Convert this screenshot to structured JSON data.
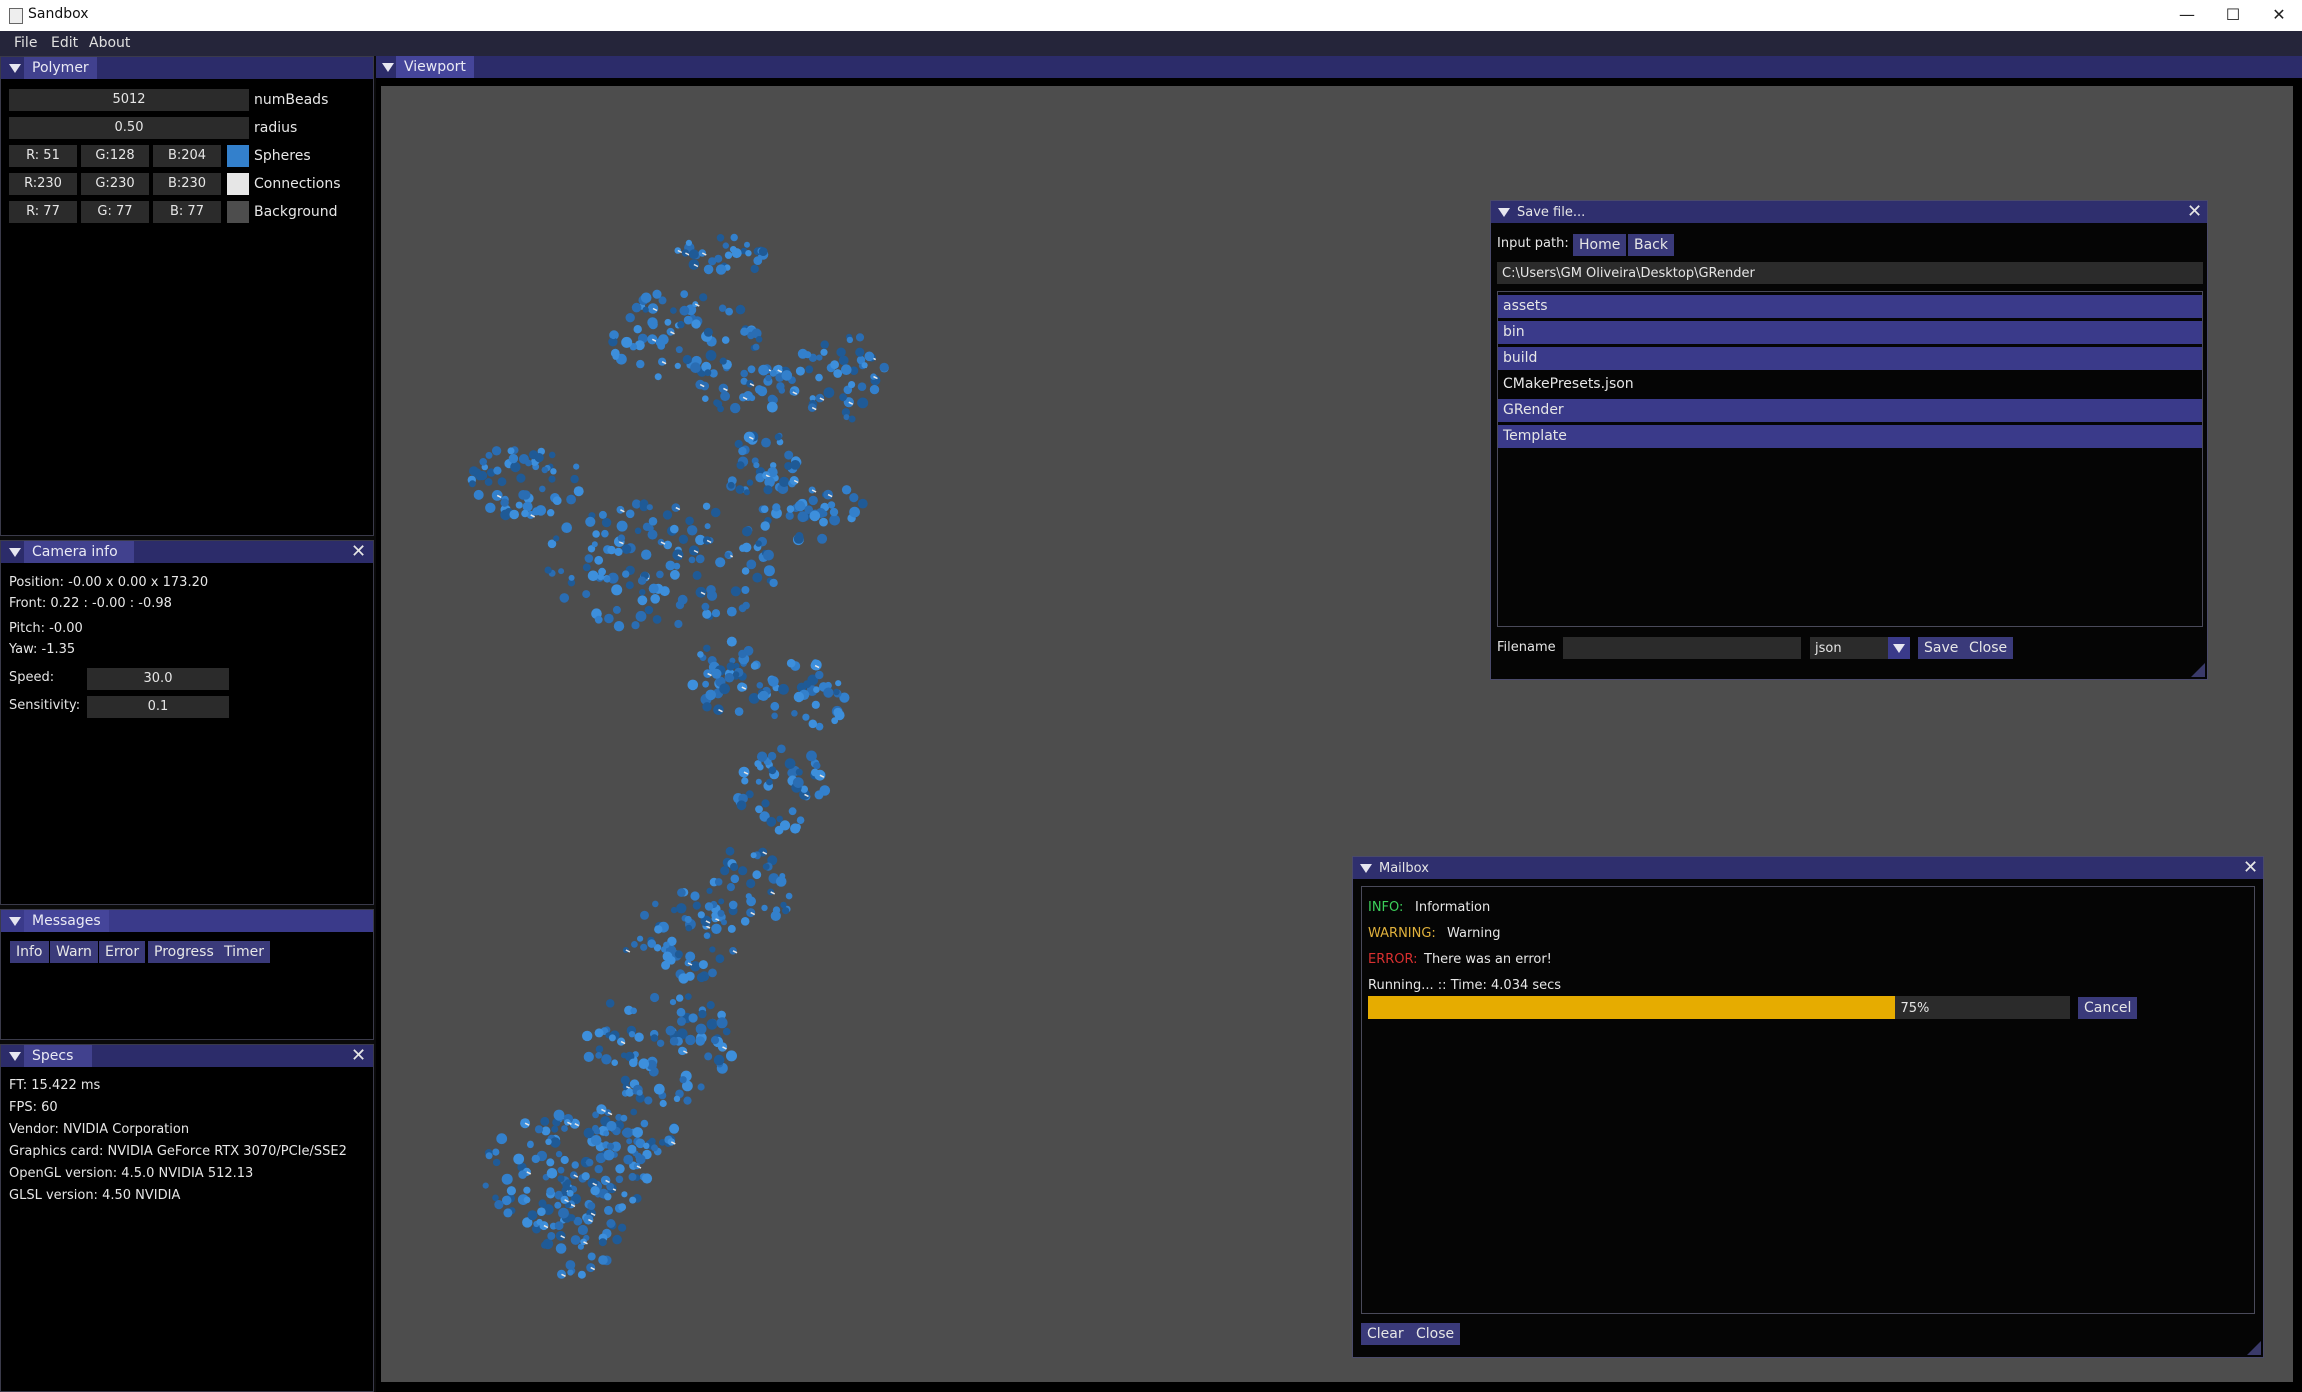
{
  "window": {
    "title": "Sandbox",
    "controls": {
      "minimize": "—",
      "maximize": "☐",
      "close": "✕"
    }
  },
  "menu": [
    "File",
    "Edit",
    "About"
  ],
  "polymer": {
    "title": "Polymer",
    "numBeads": {
      "value": "5012",
      "label": "numBeads"
    },
    "radius": {
      "value": "0.50",
      "label": "radius"
    },
    "colors": [
      {
        "r": "R: 51",
        "g": "G:128",
        "b": "B:204",
        "swatch": "#3380cc",
        "label": "Spheres"
      },
      {
        "r": "R:230",
        "g": "G:230",
        "b": "B:230",
        "swatch": "#e6e6e6",
        "label": "Connections"
      },
      {
        "r": "R: 77",
        "g": "G: 77",
        "b": "B: 77",
        "swatch": "#4d4d4d",
        "label": "Background"
      }
    ]
  },
  "camera": {
    "title": "Camera info",
    "position": "Position: -0.00 x 0.00 x 173.20",
    "front": "Front: 0.22 : -0.00 : -0.98",
    "pitch": "Pitch: -0.00",
    "yaw": "Yaw: -1.35",
    "speed_label": "Speed:",
    "speed_value": "30.0",
    "sensitivity_label": "Sensitivity:",
    "sensitivity_value": "0.1"
  },
  "messages": {
    "title": "Messages",
    "buttons": [
      "Info",
      "Warn",
      "Error",
      "Progress",
      "Timer"
    ]
  },
  "specs": {
    "title": "Specs",
    "lines": [
      "FT: 15.422 ms",
      "FPS: 60",
      "Vendor: NVIDIA Corporation",
      "Graphics card: NVIDIA GeForce RTX 3070/PCIe/SSE2",
      "OpenGL version: 4.5.0 NVIDIA 512.13",
      "GLSL version: 4.50 NVIDIA"
    ]
  },
  "viewport": {
    "title": "Viewport",
    "background": "#4d4d4d",
    "bead_color": "#3380cc"
  },
  "save_file": {
    "title": "Save file...",
    "input_path_label": "Input path:",
    "home": "Home",
    "back": "Back",
    "path": "C:\\Users\\GM Oliveira\\Desktop\\GRender",
    "entries": [
      {
        "name": "assets",
        "dir": true
      },
      {
        "name": "bin",
        "dir": true
      },
      {
        "name": "build",
        "dir": true
      },
      {
        "name": "CMakePresets.json",
        "dir": false
      },
      {
        "name": "GRender",
        "dir": true
      },
      {
        "name": "Template",
        "dir": true
      }
    ],
    "filename_label": "Filename",
    "filename_value": "",
    "extension": "json",
    "save": "Save",
    "close": "Close"
  },
  "mailbox": {
    "title": "Mailbox",
    "info_tag": "INFO:",
    "info_text": "Information",
    "info_color": "#3ccf5a",
    "warning_tag": "WARNING:",
    "warning_text": "Warning",
    "warning_color": "#e0b13c",
    "error_tag": "ERROR:",
    "error_text": "There was an error!",
    "error_color": "#d93030",
    "running": "Running... :: Time: 4.034 secs",
    "progress_percent": 75,
    "progress_label": "75%",
    "progress_color": "#e6ac00",
    "cancel": "Cancel",
    "clear": "Clear",
    "close": "Close"
  }
}
